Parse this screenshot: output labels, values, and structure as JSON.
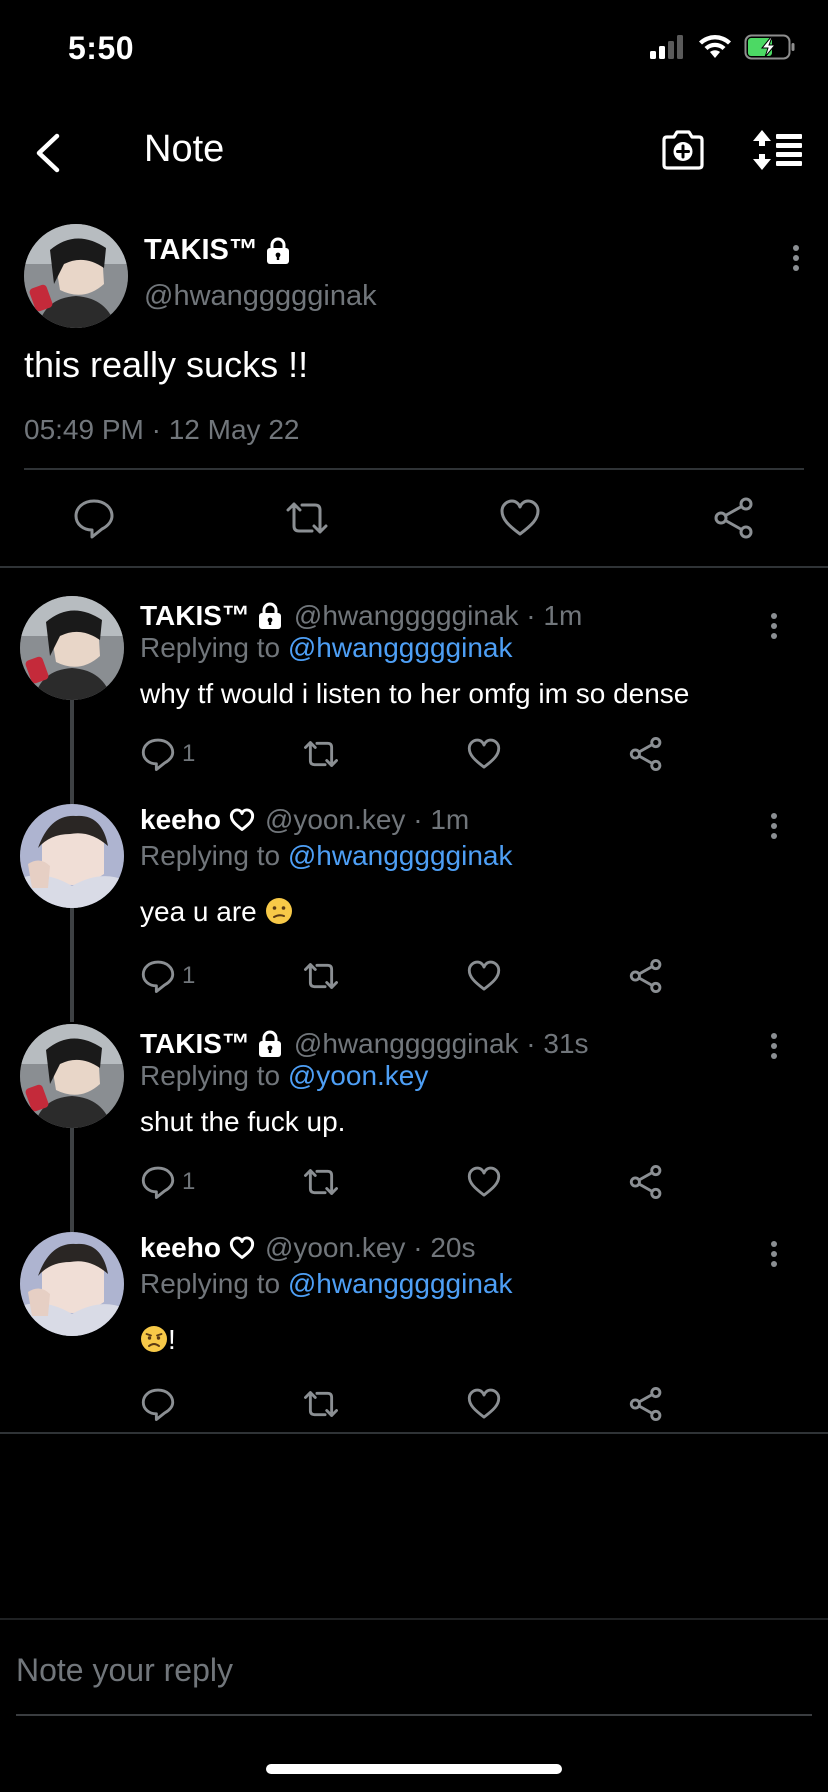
{
  "status_bar": {
    "time": "5:50"
  },
  "nav": {
    "title": "Note"
  },
  "note": {
    "author_name": "TAKIS™",
    "author_handle": "@hwanggggginak",
    "text": "this really sucks !!",
    "timestamp": "05:49 PM · 12 May 22"
  },
  "replies": [
    {
      "name": "TAKIS™",
      "badge": "lock",
      "meta": "@hwanggggginak · 1m",
      "replying_prefix": "Replying to",
      "replying_to": "@hwanggggginak",
      "text": "why tf would i listen to her omfg im so dense",
      "reply_count": "1"
    },
    {
      "name": "keeho",
      "badge": "heart",
      "meta": "@yoon.key · 1m",
      "replying_prefix": "Replying to",
      "replying_to": "@hwanggggginak",
      "text": "yea u are",
      "emoji": "confused-face",
      "reply_count": "1"
    },
    {
      "name": "TAKIS™",
      "badge": "lock",
      "meta": "@hwanggggginak · 31s",
      "replying_prefix": "Replying to",
      "replying_to": "@yoon.key",
      "text": "shut the fuck up.",
      "reply_count": "1"
    },
    {
      "name": "keeho",
      "badge": "heart",
      "meta": "@yoon.key · 20s",
      "replying_prefix": "Replying to",
      "replying_to": "@hwanggggginak",
      "text": "!",
      "emoji": "worried-face",
      "reply_count": ""
    }
  ],
  "composer": {
    "placeholder": "Note your reply"
  },
  "colors": {
    "background": "#000000",
    "muted": "#71767b",
    "mention": "#4e9ff5",
    "battery_charge": "#4cd964"
  }
}
